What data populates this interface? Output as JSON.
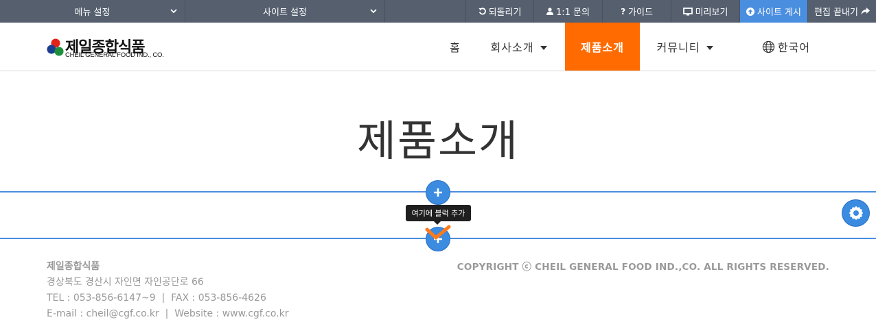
{
  "admin_bar": {
    "menu_settings": "메뉴 설정",
    "site_settings": "사이트 설정",
    "undo": "되돌리기",
    "inquiry": "1:1 문의",
    "guide": "가이드",
    "preview": "미리보기",
    "publish": "사이트 게시",
    "finish_edit": "편집 끝내기"
  },
  "logo": {
    "name_ko": "제일종합식품",
    "name_en": "CHEIL GENERAL FOOD IND., CO."
  },
  "nav": {
    "home": "홈",
    "company": "회사소개",
    "products": "제품소개",
    "community": "커뮤니티",
    "language": "한국어"
  },
  "page": {
    "title": "제품소개"
  },
  "editor": {
    "add_block_tooltip": "여기에 블럭 추가"
  },
  "footer": {
    "company": "제일종합식품",
    "address": "경상북도 경산시 자인면 자인공단로 66",
    "contact": "TEL : 053-856-6147~9  |  FAX : 053-856-4626",
    "web": "E-mail : cheil@cgf.co.kr  |  Website : www.cgf.co.kr",
    "copyright": "COPYRIGHT ⓒ CHEIL GENERAL FOOD IND.,CO. ALL RIGHTS RESERVED."
  },
  "colors": {
    "admin_bg": "#555f6e",
    "publish_bg": "#4a8ee0",
    "accent_orange": "#ff6b00",
    "editor_blue": "#3b8be0"
  }
}
